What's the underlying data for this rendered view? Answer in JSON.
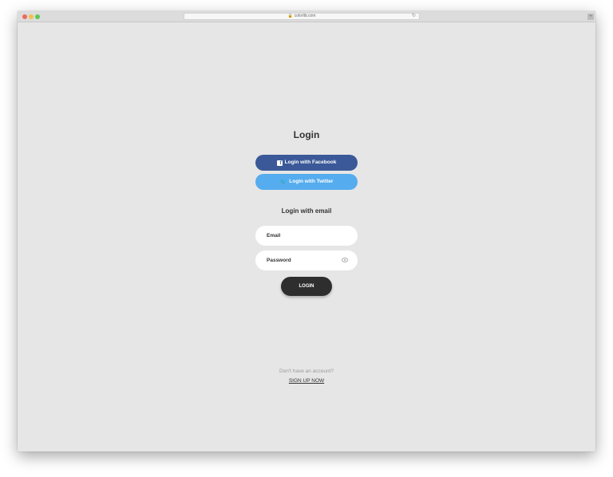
{
  "browser": {
    "url": "colorlib.com"
  },
  "login": {
    "title": "Login",
    "facebook_label": "Login with Facebook",
    "twitter_label": "Login with Twitter",
    "email_heading": "Login with email",
    "email_placeholder": "Email",
    "password_placeholder": "Password",
    "submit_label": "LOGIN"
  },
  "footer": {
    "no_account_text": "Don't have an account?",
    "signup_label": "SIGN UP NOW"
  },
  "colors": {
    "facebook": "#3b5998",
    "twitter": "#55acee",
    "login_button": "#2e2e2e",
    "background": "#e6e6e6"
  },
  "icons": {
    "facebook": "facebook-icon",
    "twitter": "twitter-icon",
    "password_toggle": "eye-icon"
  }
}
